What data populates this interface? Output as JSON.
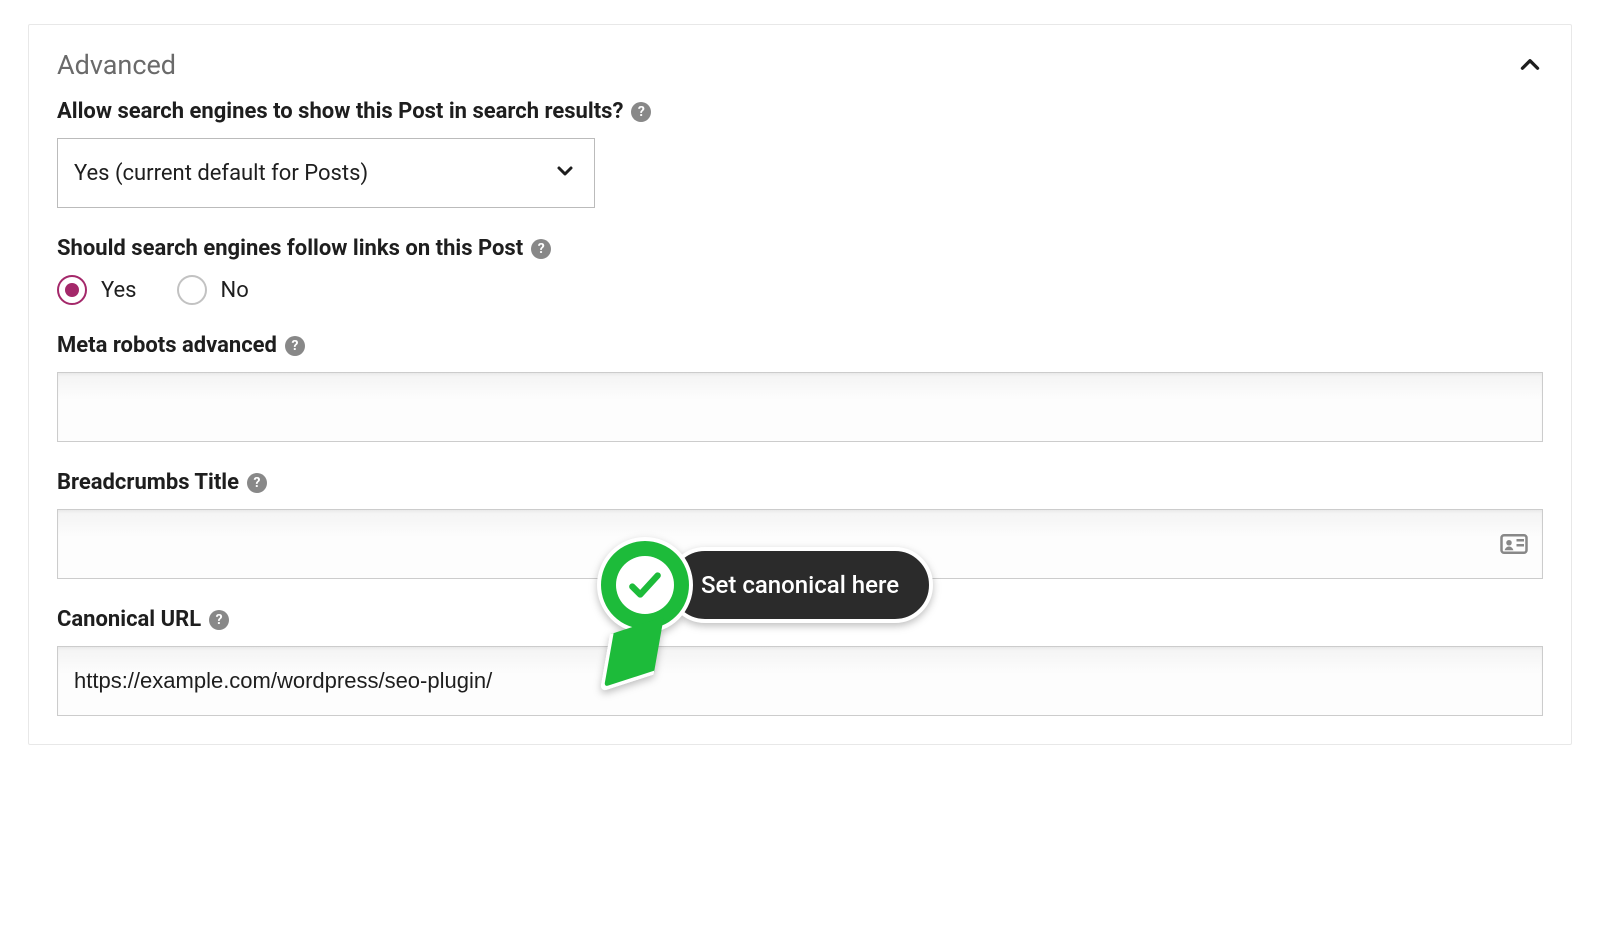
{
  "panel": {
    "title": "Advanced"
  },
  "fields": {
    "allow_search": {
      "label": "Allow search engines to show this Post in search results?",
      "value": "Yes (current default for Posts)"
    },
    "follow_links": {
      "label": "Should search engines follow links on this Post",
      "options": {
        "yes": "Yes",
        "no": "No"
      },
      "selected": "yes"
    },
    "meta_robots": {
      "label": "Meta robots advanced",
      "value": ""
    },
    "breadcrumbs": {
      "label": "Breadcrumbs Title",
      "value": ""
    },
    "canonical": {
      "label": "Canonical URL",
      "value": "https://example.com/wordpress/seo-plugin/"
    }
  },
  "callout": {
    "text": "Set canonical here"
  }
}
